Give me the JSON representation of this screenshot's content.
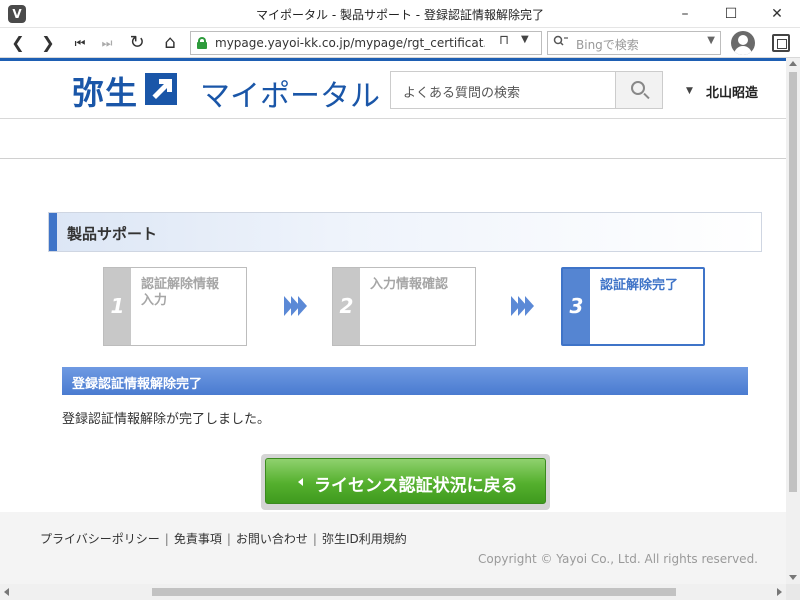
{
  "window": {
    "app_icon_letter": "V",
    "title": "マイポータル - 製品サポート - 登録認証情報解除完了",
    "minimize": "–",
    "maximize": "☐",
    "close": "✕"
  },
  "toolbar": {
    "back": "❮",
    "forward": "❯",
    "first": "⏮",
    "last": "⏭",
    "reload": "↻",
    "home": "⌂",
    "url": "mypage.yayoi-kk.co.jp/mypage/rgt_certificat...",
    "bookmark": "⊓",
    "url_dropdown": "▼",
    "search_glyph": "🔍",
    "search_placeholder": "Bingで検索",
    "search_dropdown": "▼",
    "icons": [
      "back-icon",
      "forward-icon",
      "first-icon",
      "last-icon",
      "reload-icon",
      "home-icon",
      "lock-icon",
      "bookmark-icon",
      "search-icon",
      "profile-icon",
      "capture-icon"
    ]
  },
  "header": {
    "logo_brand": "弥生",
    "logo_product": "マイポータル",
    "search_placeholder": "よくある質問の検索",
    "user_dropdown": "▼",
    "user_name": "北山昭造",
    "brand_color": "#1a56a8"
  },
  "section": {
    "title": "製品サポート"
  },
  "steps": [
    {
      "number": "1",
      "label": "認証解除情報\n入力",
      "active": false
    },
    {
      "number": "2",
      "label": "入力情報確認",
      "active": false
    },
    {
      "number": "3",
      "label": "認証解除完了",
      "active": true
    }
  ],
  "complete": {
    "bar_title": "登録認証情報解除完了",
    "message": "登録認証情報解除が完了しました。",
    "bar_color": "#4a7bd0"
  },
  "return_button": {
    "label": "ライセンス認証状況に戻る",
    "color": "#55b02e"
  },
  "footer": {
    "links": [
      "プライバシーポリシー",
      "免責事項",
      "お問い合わせ",
      "弥生ID利用規約"
    ],
    "separator": "|",
    "copyright": "Copyright © Yayoi Co., Ltd. All rights reserved."
  }
}
